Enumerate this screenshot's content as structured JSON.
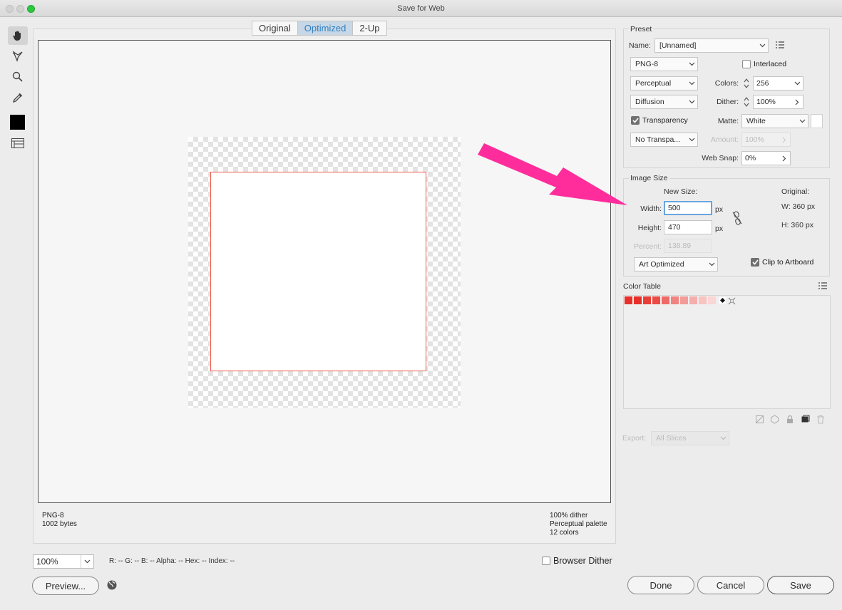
{
  "window": {
    "title": "Save for Web"
  },
  "tabs": [
    {
      "label": "Original"
    },
    {
      "label": "Optimized"
    },
    {
      "label": "2-Up"
    }
  ],
  "image_info": {
    "left_line1": "PNG-8",
    "left_line2": "1002 bytes",
    "right_line1": "100% dither",
    "right_line2": "Perceptual palette",
    "right_line3": "12 colors"
  },
  "bottom": {
    "zoom": "100%",
    "readout": "R: --  G: --  B: --  Alpha: --  Hex: --  Index: --",
    "browser_dither_label": "Browser Dither",
    "browser_dither_checked": false,
    "preview_button": "Preview...",
    "done_button": "Done",
    "cancel_button": "Cancel",
    "save_button": "Save"
  },
  "preset": {
    "section_label": "Preset",
    "name_label": "Name:",
    "name_value": "[Unnamed]",
    "format": "PNG-8",
    "interlaced_label": "Interlaced",
    "interlaced_checked": false,
    "reduction": "Perceptual",
    "colors_label": "Colors:",
    "colors_value": "256",
    "dither_algo": "Diffusion",
    "dither_label": "Dither:",
    "dither_value": "100%",
    "transparency_label": "Transparency",
    "transparency_checked": true,
    "matte_label": "Matte:",
    "matte_value": "White",
    "transparency_dither": "No Transpa...",
    "amount_label": "Amount:",
    "amount_value": "100%",
    "websnap_label": "Web Snap:",
    "websnap_value": "0%"
  },
  "image_size": {
    "section_label": "Image Size",
    "new_size_label": "New Size:",
    "original_label": "Original:",
    "width_label": "Width:",
    "width_value": "500",
    "height_label": "Height:",
    "height_value": "470",
    "unit": "px",
    "orig_w": "W:  360 px",
    "orig_h": "H:  360 px",
    "percent_label": "Percent:",
    "percent_value": "138.89",
    "quality": "Art Optimized",
    "clip_label": "Clip to Artboard",
    "clip_checked": true
  },
  "color_table": {
    "label": "Color Table",
    "swatches": [
      "#e8302a",
      "#e8302a",
      "#ea3d38",
      "#ec4a44",
      "#ef6a66",
      "#f08480",
      "#f39b98",
      "#f5aeac",
      "#f8c4c2",
      "#fad6d4"
    ]
  },
  "export": {
    "label": "Export:",
    "value": "All Slices"
  },
  "colors": {
    "accent": "#2e7fc1",
    "artboard_border": "#ea5a4a",
    "annotation_arrow": "#ff2d9c"
  }
}
